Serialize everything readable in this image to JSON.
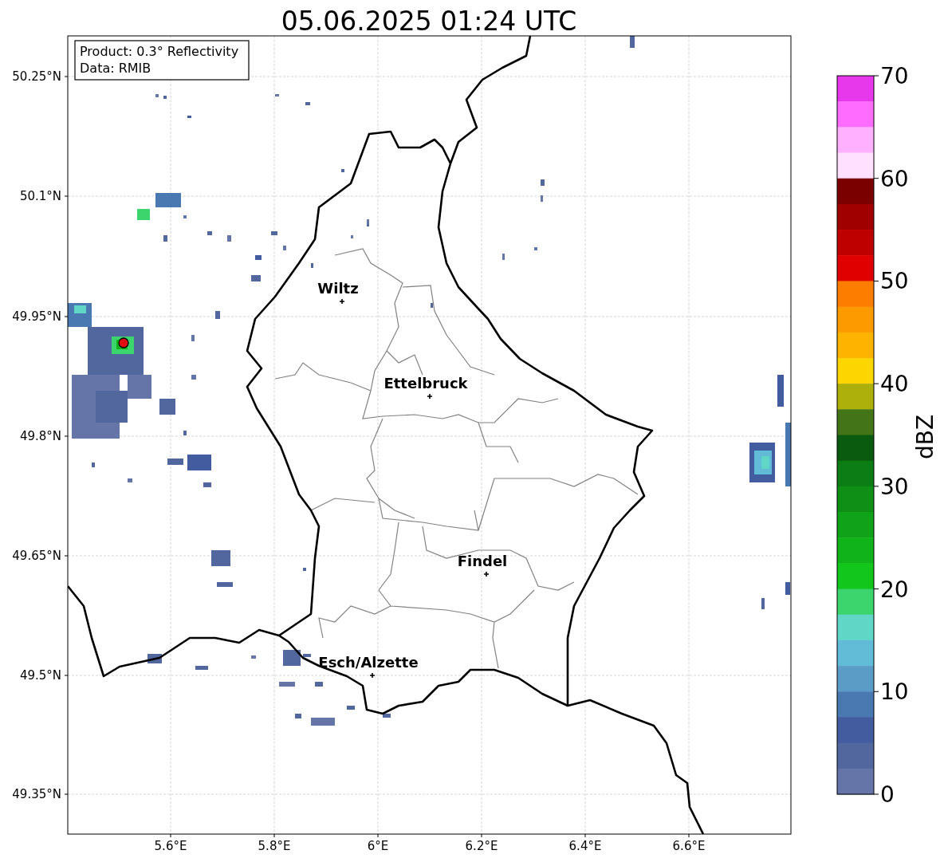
{
  "title": "05.06.2025 01:24 UTC",
  "info_box": [
    "Product: 0.3° Reflectivity",
    "Data: RMIB"
  ],
  "map": {
    "x_ticks": [
      "5.6°E",
      "5.8°E",
      "6°E",
      "6.2°E",
      "6.4°E",
      "6.6°E"
    ],
    "y_ticks": [
      "50.25°N",
      "50.1°N",
      "49.95°N",
      "49.8°N",
      "49.65°N",
      "49.5°N",
      "49.35°N"
    ],
    "cities": [
      "Wiltz",
      "Ettelbruck",
      "Findel",
      "Esch/Alzette"
    ]
  },
  "colorbar": {
    "label": "dBZ",
    "ticks": [
      "70",
      "60",
      "50",
      "40",
      "30",
      "20",
      "10",
      "0"
    ],
    "segments": [
      {
        "color": "#e838ec"
      },
      {
        "color": "#ff6cff"
      },
      {
        "color": "#ffb0ff"
      },
      {
        "color": "#ffe0ff"
      },
      {
        "color": "#7a0000"
      },
      {
        "color": "#a00000"
      },
      {
        "color": "#bf0000"
      },
      {
        "color": "#e00000"
      },
      {
        "color": "#fd7d00"
      },
      {
        "color": "#fd9a00"
      },
      {
        "color": "#fdb300"
      },
      {
        "color": "#fdd500"
      },
      {
        "color": "#adaf0b"
      },
      {
        "color": "#437417"
      },
      {
        "color": "#0a5a10"
      },
      {
        "color": "#0c7c14"
      },
      {
        "color": "#0f8f16"
      },
      {
        "color": "#10a218"
      },
      {
        "color": "#10b41a"
      },
      {
        "color": "#12c61c"
      },
      {
        "color": "#3cd46c"
      },
      {
        "color": "#5fd6c6"
      },
      {
        "color": "#62bcd8"
      },
      {
        "color": "#5a9cc6"
      },
      {
        "color": "#4a78b0"
      },
      {
        "color": "#425c9f"
      },
      {
        "color": "#52679e"
      },
      {
        "color": "#6675a8"
      }
    ]
  }
}
